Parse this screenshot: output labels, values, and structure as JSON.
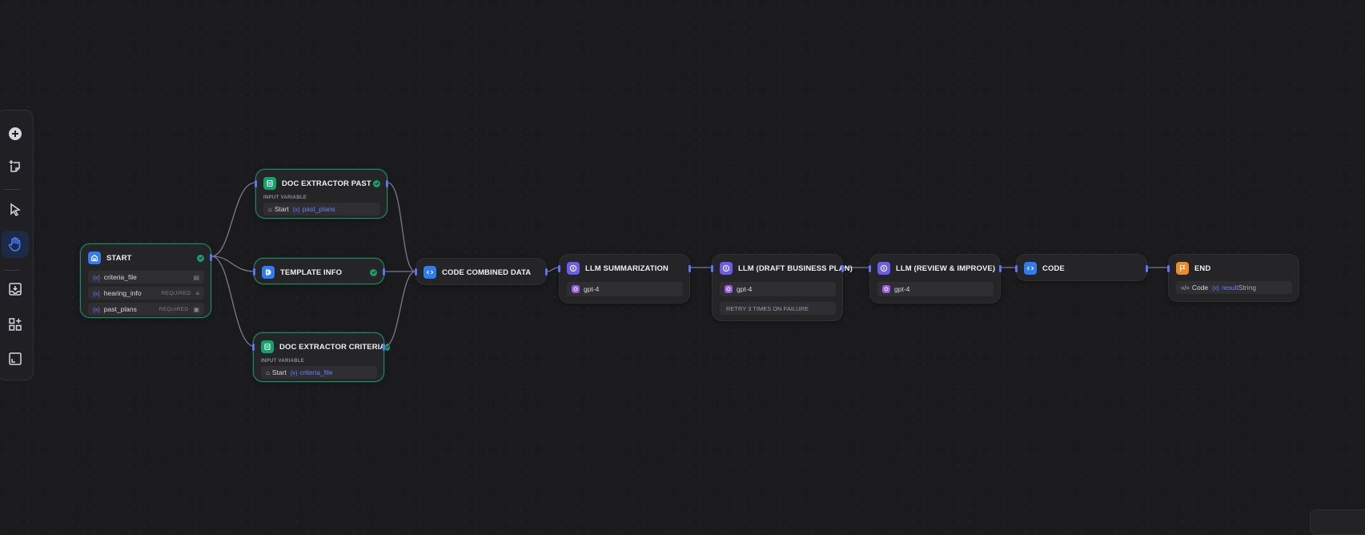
{
  "colors": {
    "canvas_bg": "#1b1b1d",
    "node_bg": "#252528",
    "success_border": "#1e8a63",
    "edge": "#7a7a8c",
    "variable_blue": "#6d7ff9",
    "icon_blue": "#2e7cf6",
    "icon_green": "#11a36e",
    "icon_indigo": "#6a5cf0",
    "icon_orange": "#f08a24",
    "model_purple": "#9b5de5"
  },
  "toolbar": {
    "tools": [
      {
        "name": "add-node-icon"
      },
      {
        "name": "add-note-icon"
      },
      {
        "name": "pointer-icon"
      },
      {
        "name": "hand-icon",
        "active": true
      },
      {
        "name": "export-image-icon"
      },
      {
        "name": "organize-blocks-icon"
      },
      {
        "name": "fit-view-icon"
      }
    ]
  },
  "nodes": {
    "start": {
      "title": "START",
      "icon": "home-icon",
      "variables": [
        {
          "var": "{x}",
          "name": "criteria_file",
          "required": "",
          "type_icon": "file-icon"
        },
        {
          "var": "{x}",
          "name": "hearing_info",
          "required": "REQUIRED",
          "type_icon": "paragraph-icon"
        },
        {
          "var": "{x}",
          "name": "past_plans",
          "required": "REQUIRED",
          "type_icon": "file-list-icon"
        }
      ]
    },
    "doc_past": {
      "title": "DOC EXTRACTOR PAST",
      "icon": "doc-extractor-icon",
      "input_label": "INPUT VARIABLE",
      "source": "Start",
      "var": "{x}",
      "variable": "past_plans"
    },
    "template": {
      "title": "TEMPLATE INFO",
      "icon": "template-icon"
    },
    "doc_criteria": {
      "title": "DOC EXTRACTOR CRITERIA",
      "icon": "doc-extractor-icon",
      "input_label": "INPUT VARIABLE",
      "source": "Start",
      "var": "{x}",
      "variable": "criteria_file"
    },
    "code_combined": {
      "title": "CODE COMBINED DATA",
      "icon": "code-icon"
    },
    "llm_summary": {
      "title": "LLM SUMMARIZATION",
      "icon": "llm-icon",
      "model": "gpt-4"
    },
    "llm_draft": {
      "title": "LLM (DRAFT BUSINESS PLAN)",
      "icon": "llm-icon",
      "model": "gpt-4",
      "retry": "RETRY 3 TIMES ON FAILURE"
    },
    "llm_review": {
      "title": "LLM (REVIEW & IMPROVE)",
      "icon": "llm-icon",
      "model": "gpt-4"
    },
    "code": {
      "title": "CODE",
      "icon": "code-icon"
    },
    "end": {
      "title": "END",
      "icon": "end-icon",
      "source": "Code",
      "var": "{x}",
      "var_name": "result",
      "var_type": "String"
    }
  }
}
